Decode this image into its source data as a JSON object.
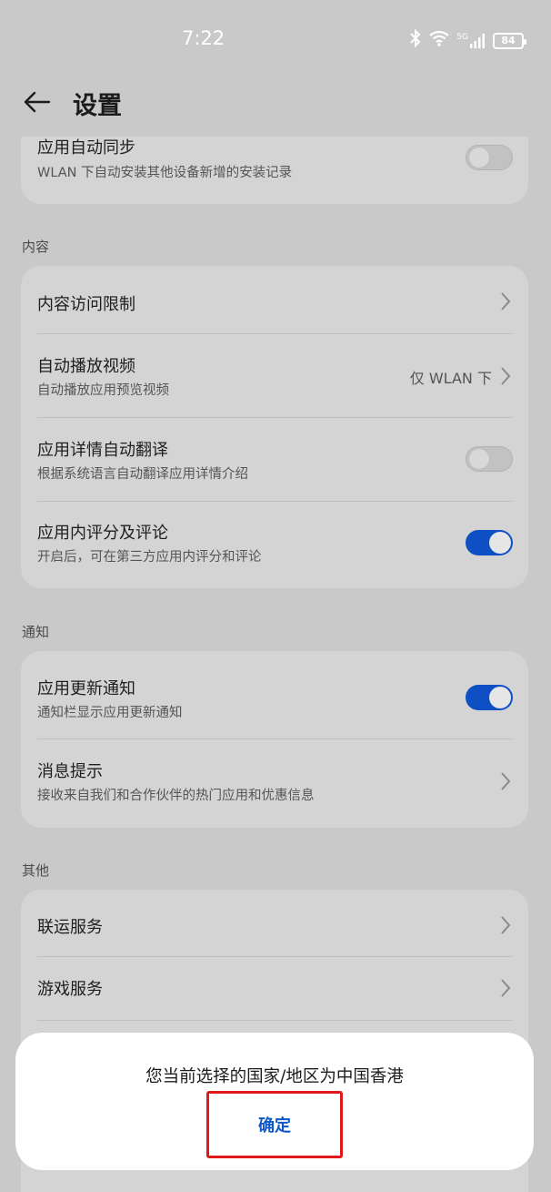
{
  "status": {
    "time": "7:22",
    "network": "5G",
    "battery": "84"
  },
  "header": {
    "title": "设置"
  },
  "top_card": {
    "title": "应用自动同步",
    "subtitle": "WLAN 下自动安装其他设备新增的安装记录",
    "toggle": "off"
  },
  "sections": {
    "content_label": "内容",
    "notify_label": "通知",
    "other_label": "其他"
  },
  "content": {
    "access_limit": {
      "title": "内容访问限制"
    },
    "autoplay": {
      "title": "自动播放视频",
      "subtitle": "自动播放应用预览视频",
      "value": "仅 WLAN 下"
    },
    "auto_translate": {
      "title": "应用详情自动翻译",
      "subtitle": "根据系统语言自动翻译应用详情介绍",
      "toggle": "off"
    },
    "in_app_rating": {
      "title": "应用内评分及评论",
      "subtitle": "开启后，可在第三方应用内评分和评论",
      "toggle": "on"
    }
  },
  "notify": {
    "update": {
      "title": "应用更新通知",
      "subtitle": "通知栏显示应用更新通知",
      "toggle": "on"
    },
    "message": {
      "title": "消息提示",
      "subtitle": "接收来自我们和合作伙伴的热门应用和优惠信息"
    }
  },
  "other": {
    "joint_ops": {
      "title": "联运服务"
    },
    "game": {
      "title": "游戏服务"
    }
  },
  "dialog": {
    "message": "您当前选择的国家/地区为中国香港",
    "confirm_label": "确定"
  },
  "colors": {
    "accent": "#0f4fc4",
    "highlight": "#e01818"
  }
}
